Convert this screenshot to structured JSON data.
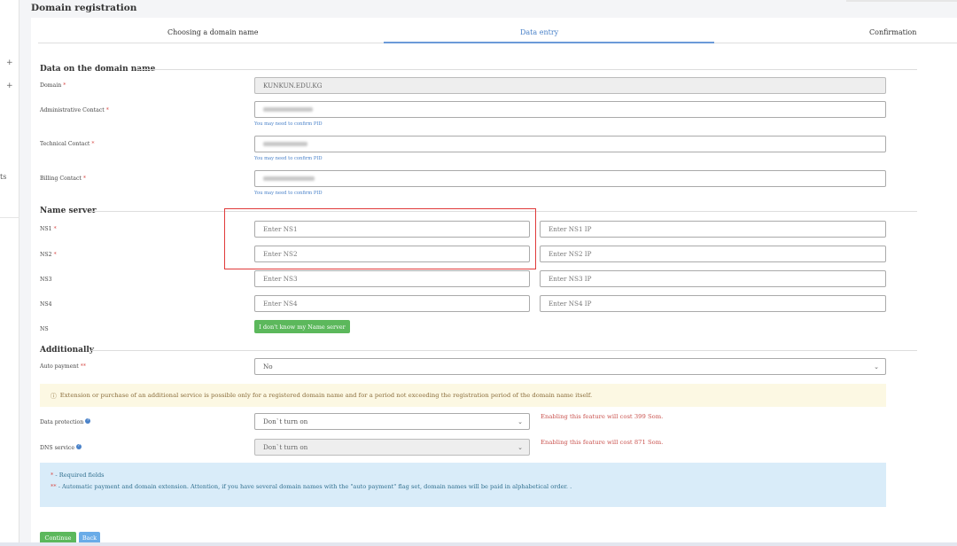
{
  "page": {
    "title": "Domain registration",
    "sidebar_fragment": "ts"
  },
  "steps": [
    {
      "label": "Choosing a domain name",
      "active": false
    },
    {
      "label": "Data entry",
      "active": true
    },
    {
      "label": "Confirmation",
      "active": false
    }
  ],
  "domain_section": {
    "title": "Data on the domain name",
    "domain": {
      "label": "Domain",
      "value": "KUNKUN.EDU.KG"
    },
    "admin_contact": {
      "label": "Administrative Contact",
      "help": "You may need to confirm PID"
    },
    "tech_contact": {
      "label": "Technical Contact",
      "help": "You may need to confirm PID"
    },
    "billing_contact": {
      "label": "Billing Contact",
      "help": "You may need to confirm PID"
    }
  },
  "name_server": {
    "title": "Name server",
    "rows": [
      {
        "label": "NS1",
        "required": true,
        "ns_placeholder": "Enter NS1",
        "ip_placeholder": "Enter NS1 IP"
      },
      {
        "label": "NS2",
        "required": true,
        "ns_placeholder": "Enter NS2",
        "ip_placeholder": "Enter NS2 IP"
      },
      {
        "label": "NS3",
        "required": false,
        "ns_placeholder": "Enter NS3",
        "ip_placeholder": "Enter NS3 IP"
      },
      {
        "label": "NS4",
        "required": false,
        "ns_placeholder": "Enter NS4",
        "ip_placeholder": "Enter NS4 IP"
      }
    ],
    "ns_label": "NS",
    "dont_know_button": "I don't know my Name server"
  },
  "additionally": {
    "title": "Additionally",
    "auto_payment": {
      "label": "Auto payment",
      "value": "No"
    },
    "warning": "Extension or purchase of an additional service is possible only for a registered domain name and for a period not exceeding the registration period of the domain name itself.",
    "data_protection": {
      "label": "Data protection",
      "value": "Don`t turn on",
      "cost": "Enabling this feature will cost 399 Som."
    },
    "dns_service": {
      "label": "DNS service",
      "value": "Don`t turn on",
      "cost": "Enabling this feature will cost 871 Som."
    }
  },
  "info": {
    "required_note": "- Required fields",
    "auto_note": "- Automatic payment and domain extension. Attention, if you have several domain names with the \"auto payment\" flag set, domain names will be paid in alphabetical order. ."
  },
  "actions": {
    "continue": "Continue",
    "back": "Back"
  },
  "colors": {
    "accent": "#4a82c9",
    "highlight": "#e03a3a",
    "success": "#5cb85c",
    "danger": "#d9534f"
  }
}
